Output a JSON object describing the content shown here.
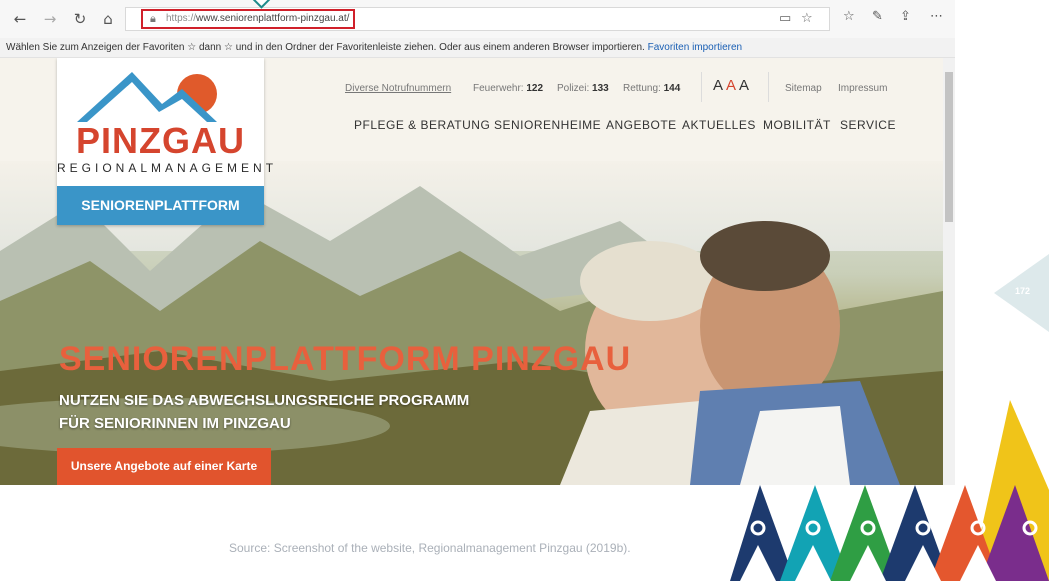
{
  "browser": {
    "url_protocol": "https://",
    "url_host": "www.seniorenplattform-pinzgau.at/",
    "favorites_bar_text": "Wählen Sie zum Anzeigen der Favoriten ☆ dann ☆ und in den Ordner der Favoritenleiste ziehen. Oder aus einem anderen Browser importieren.",
    "favorites_import_link": "Favoriten importieren",
    "icons": [
      "back-icon",
      "forward-icon",
      "refresh-icon",
      "home-icon",
      "lock-icon",
      "reading-view-icon",
      "star-icon",
      "favorites-icon",
      "pen-icon",
      "share-icon",
      "more-icon"
    ]
  },
  "site": {
    "logo": {
      "main": "PINZGAU",
      "sub": "REGIONALMANAGEMENT",
      "band": "SENIORENPLATTFORM"
    },
    "info": {
      "notruf_link": "Diverse Notrufnummern",
      "feuerwehr_label": "Feuerwehr:",
      "feuerwehr_num": "122",
      "polizei_label": "Polizei:",
      "polizei_num": "133",
      "rettung_label": "Rettung:",
      "rettung_num": "144",
      "aaa": [
        "A",
        "A",
        "A"
      ],
      "sitemap": "Sitemap",
      "impressum": "Impressum"
    },
    "menu": [
      "PFLEGE & BERATUNG",
      "SENIORENHEIME",
      "ANGEBOTE",
      "AKTUELLES",
      "MOBILITÄT",
      "SERVICE"
    ],
    "hero": {
      "title": "SENIORENPLATTFORM PINZGAU",
      "line1": "NUTZEN SIE DAS ABWECHSLUNGSREICHE PROGRAMM",
      "line2": "FÜR SENIORINNEN IM PINZGAU",
      "cta": "Unsere Angebote auf einer Karte"
    }
  },
  "slide": {
    "page_number": "172",
    "source": "Source: Screenshot of the website, Regionalmanagement Pinzgau (2019b)."
  },
  "colors": {
    "accent": "#e1542d",
    "logo_blue": "#3a95c8",
    "highlight": "#d0202a",
    "teal": "#1e8a8a"
  }
}
